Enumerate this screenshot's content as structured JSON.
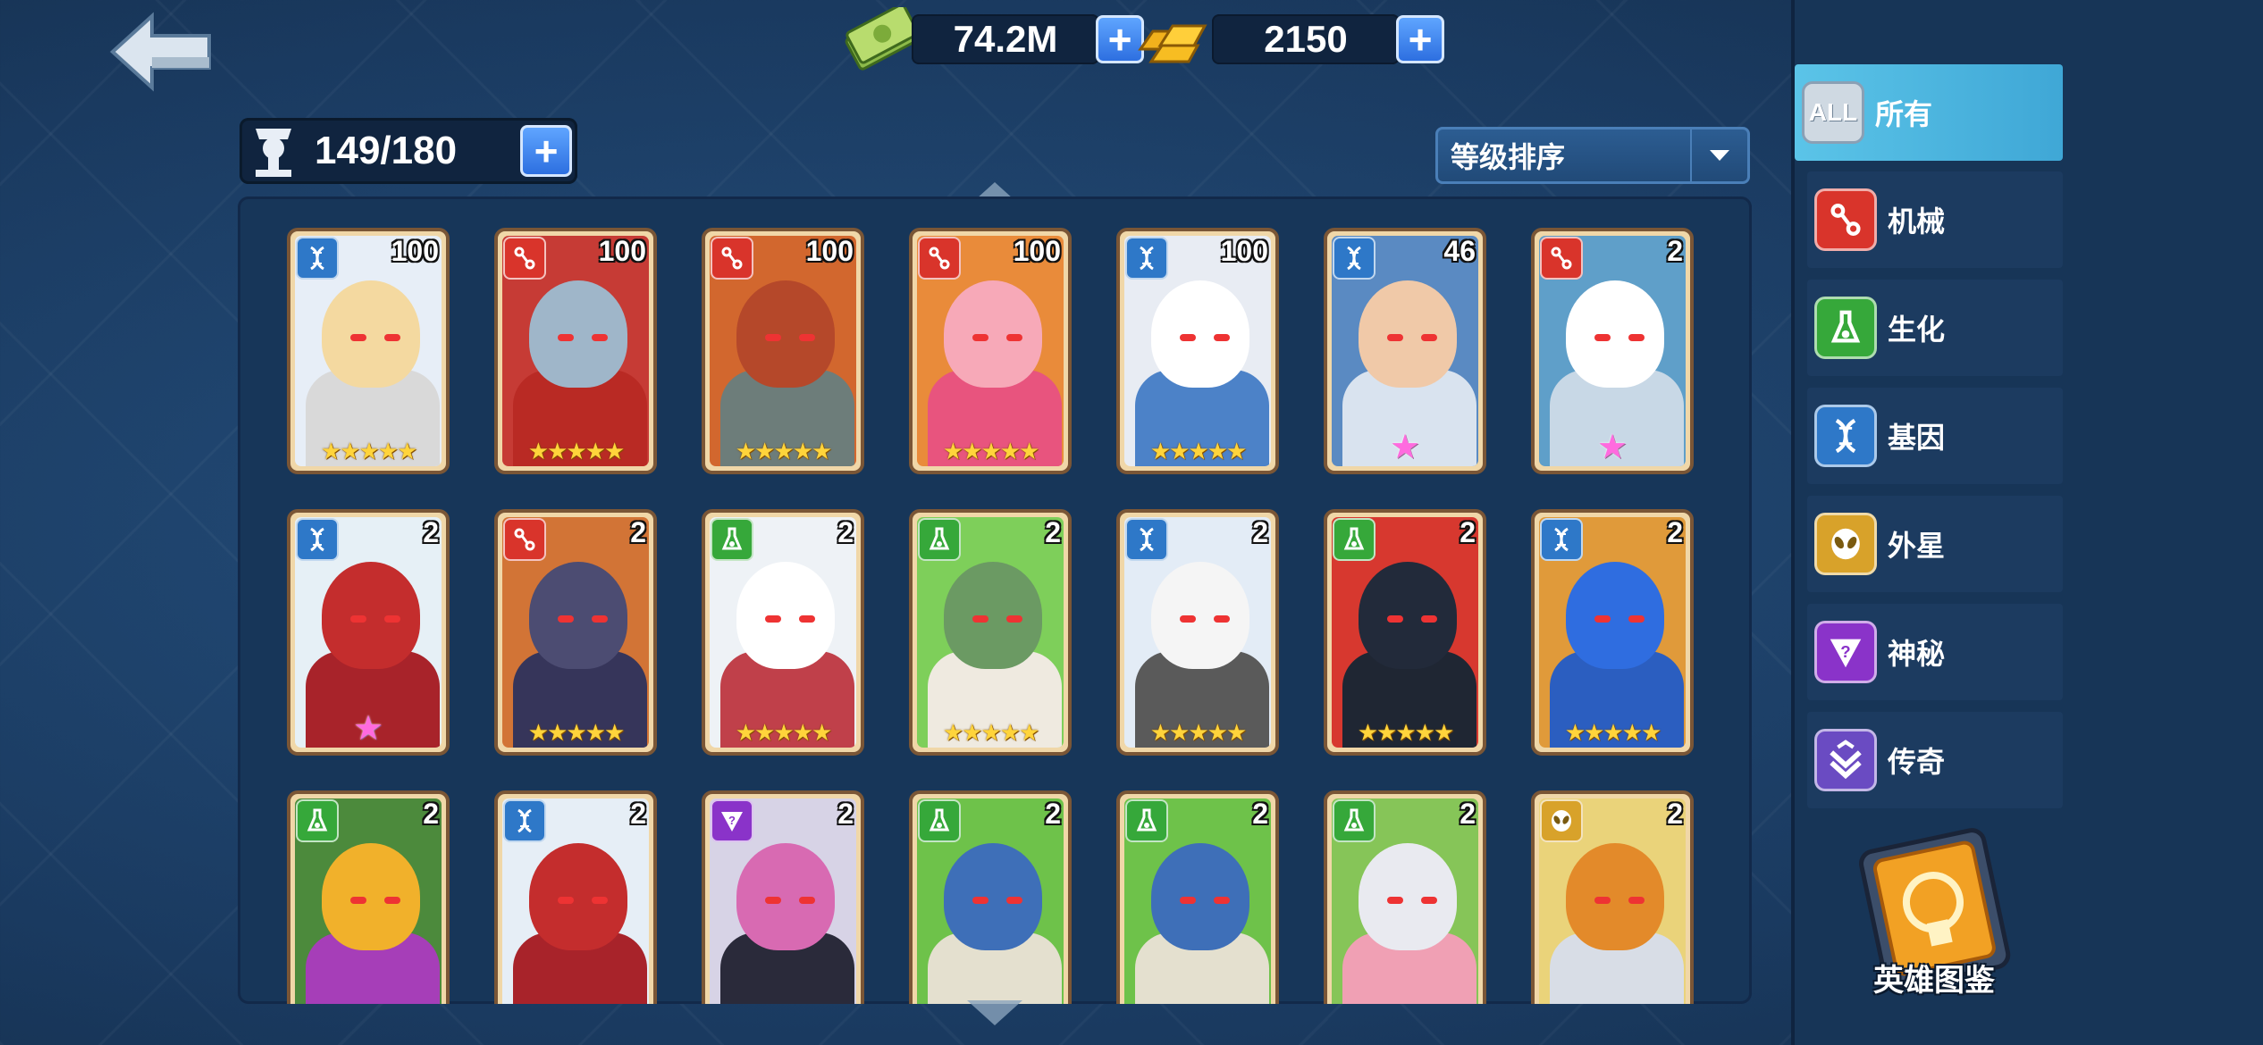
{
  "topbar": {
    "back_icon": "back-arrow-icon",
    "cash": {
      "icon": "cash-icon",
      "value": "74.2M"
    },
    "gold": {
      "icon": "gold-bar-icon",
      "value": "2150"
    }
  },
  "capacity": {
    "icon": "hero-capacity-icon",
    "value": "149/180"
  },
  "sort": {
    "label": "等级排序",
    "icon": "chevron-down-icon"
  },
  "faction_colors": {
    "mechanic": "#d9342b",
    "gene": "#2e78c8",
    "bio": "#36a83a",
    "alien": "#d8a22a",
    "mystery": "#8a33c9",
    "legend": "#6a4bc2"
  },
  "heroes": [
    {
      "faction": "gene",
      "level": "100",
      "stars": "★★★★★",
      "art_bg": "#e7eef7",
      "art_skin": "#f4d9a0",
      "art_body": "#d9d9d9"
    },
    {
      "faction": "mechanic",
      "level": "100",
      "stars": "★★★★★",
      "art_bg": "#c63b35",
      "art_skin": "#9fb6c9",
      "art_body": "#b92a24"
    },
    {
      "faction": "mechanic",
      "level": "100",
      "stars": "★★★★★",
      "art_bg": "#d2672e",
      "art_skin": "#b5482a",
      "art_body": "#6d7d7a"
    },
    {
      "faction": "mechanic",
      "level": "100",
      "stars": "★★★★★",
      "art_bg": "#e98b3a",
      "art_skin": "#f7a9b8",
      "art_body": "#e8547e"
    },
    {
      "faction": "gene",
      "level": "100",
      "stars": "★★★★★",
      "art_bg": "#e8ecf3",
      "art_skin": "#ffffff",
      "art_body": "#4c82c8"
    },
    {
      "faction": "gene",
      "level": "46",
      "stars": "★",
      "art_bg": "#5a8ac2",
      "art_skin": "#f0c9a8",
      "art_body": "#d9e3ef"
    },
    {
      "faction": "mechanic",
      "level": "2",
      "stars": "★",
      "art_bg": "#5f9fc9",
      "art_skin": "#ffffff",
      "art_body": "#c8d8e6"
    },
    {
      "faction": "gene",
      "level": "2",
      "stars": "★",
      "art_bg": "#e6f0f6",
      "art_skin": "#c42d2d",
      "art_body": "#a8232a"
    },
    {
      "faction": "mechanic",
      "level": "2",
      "stars": "★★★★★",
      "art_bg": "#d27436",
      "art_skin": "#4c4c72",
      "art_body": "#36355a"
    },
    {
      "faction": "bio",
      "level": "2",
      "stars": "★★★★★",
      "art_bg": "#eef2f6",
      "art_skin": "#ffffff",
      "art_body": "#c0404a"
    },
    {
      "faction": "bio",
      "level": "2",
      "stars": "★★★★★",
      "art_bg": "#7ecf5a",
      "art_skin": "#6b9a63",
      "art_body": "#efeae0"
    },
    {
      "faction": "gene",
      "level": "2",
      "stars": "★★★★★",
      "art_bg": "#e3ecf6",
      "art_skin": "#f5f5f5",
      "art_body": "#5a5a5a"
    },
    {
      "faction": "bio",
      "level": "2",
      "stars": "★★★★★",
      "art_bg": "#d7382f",
      "art_skin": "#222a3a",
      "art_body": "#1f2633"
    },
    {
      "faction": "gene",
      "level": "2",
      "stars": "★★★★★",
      "art_bg": "#e09a3a",
      "art_skin": "#2f6de0",
      "art_body": "#2b5ec0"
    },
    {
      "faction": "bio",
      "level": "2",
      "stars": "",
      "art_bg": "#4c8a3c",
      "art_skin": "#f1b12b",
      "art_body": "#a63eb8"
    },
    {
      "faction": "gene",
      "level": "2",
      "stars": "",
      "art_bg": "#e6eef6",
      "art_skin": "#c42d2d",
      "art_body": "#a8232a"
    },
    {
      "faction": "mystery",
      "level": "2",
      "stars": "",
      "art_bg": "#d7d3e6",
      "art_skin": "#d86ab2",
      "art_body": "#2a2a3a"
    },
    {
      "faction": "bio",
      "level": "2",
      "stars": "",
      "art_bg": "#6ec24a",
      "art_skin": "#3e6fb8",
      "art_body": "#e4e0cf"
    },
    {
      "faction": "bio",
      "level": "2",
      "stars": "",
      "art_bg": "#6ec24a",
      "art_skin": "#3e6fb8",
      "art_body": "#e4e0cf"
    },
    {
      "faction": "bio",
      "level": "2",
      "stars": "",
      "art_bg": "#86c558",
      "art_skin": "#e9eaf0",
      "art_body": "#f0a0b4"
    },
    {
      "faction": "alien",
      "level": "2",
      "stars": "",
      "art_bg": "#ead37a",
      "art_skin": "#e38a2a",
      "art_body": "#d8dde6"
    }
  ],
  "sidebar": {
    "items": [
      {
        "key": "all",
        "label": "所有",
        "icon_text": "ALL",
        "icon": "all-icon",
        "active": true
      },
      {
        "key": "mechanic",
        "label": "机械",
        "icon": "mechanic-icon"
      },
      {
        "key": "bio",
        "label": "生化",
        "icon": "flask-icon"
      },
      {
        "key": "gene",
        "label": "基因",
        "icon": "dna-icon"
      },
      {
        "key": "alien",
        "label": "外星",
        "icon": "alien-icon"
      },
      {
        "key": "mystery",
        "label": "神秘",
        "icon": "mystery-icon"
      },
      {
        "key": "legend",
        "label": "传奇",
        "icon": "legend-icon"
      }
    ],
    "codex": {
      "label": "英雄图鉴",
      "icon": "hero-codex-icon"
    }
  }
}
